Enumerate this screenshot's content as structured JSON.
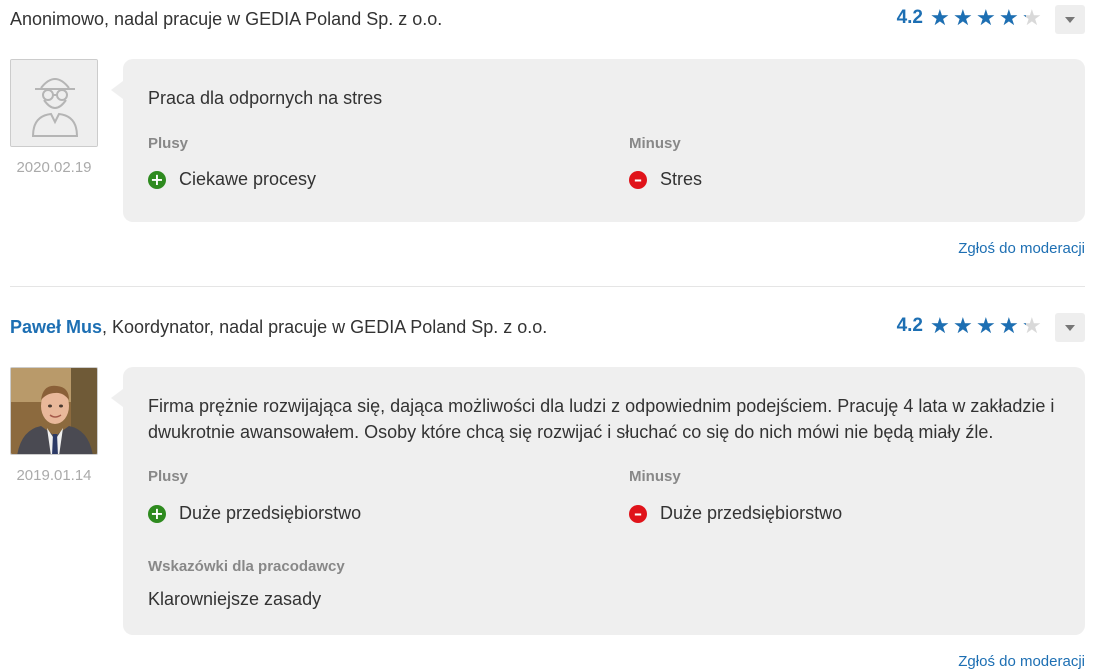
{
  "reviews": [
    {
      "author_name": "",
      "author_rest": "Anonimowo, nadal pracuje w GEDIA Poland Sp. z o.o.",
      "rating": "4.2",
      "rating_fraction": 0.84,
      "avatar_icon": "anonymous-user-icon",
      "date": "2020.02.19",
      "summary": "Praca dla odpornych na stres",
      "pros_label": "Plusy",
      "pros": [
        "Ciekawe procesy"
      ],
      "cons_label": "Minusy",
      "cons": [
        "Stres"
      ],
      "report_label": "Zgłoś do moderacji"
    },
    {
      "author_name": "Paweł Mus",
      "author_rest": ", Koordynator, nadal pracuje w GEDIA Poland Sp. z o.o.",
      "rating": "4.2",
      "rating_fraction": 0.84,
      "avatar_icon": "user-photo",
      "date": "2019.01.14",
      "summary": "Firma prężnie rozwijająca się, dająca możliwości dla ludzi z odpowiednim podejściem. Pracuję 4 lata w zakładzie i dwukrotnie awansowałem. Osoby które chcą się rozwijać i słuchać co się do nich mówi nie będą miały źle.",
      "pros_label": "Plusy",
      "pros": [
        "Duże przedsiębiorstwo"
      ],
      "cons_label": "Minusy",
      "cons": [
        "Duże przedsiębiorstwo"
      ],
      "tips_label": "Wskazówki dla pracodawcy",
      "tips": "Klarowniejsze zasady",
      "report_label": "Zgłoś do moderacji"
    }
  ],
  "icons": {
    "star": "star-icon",
    "plus": "plus-circle-icon",
    "minus": "minus-circle-icon",
    "dropdown": "chevron-down-icon"
  },
  "colors": {
    "accent": "#1d6fb3",
    "plus": "#2e8b1f",
    "minus": "#e0131a",
    "bubble": "#efefef"
  }
}
